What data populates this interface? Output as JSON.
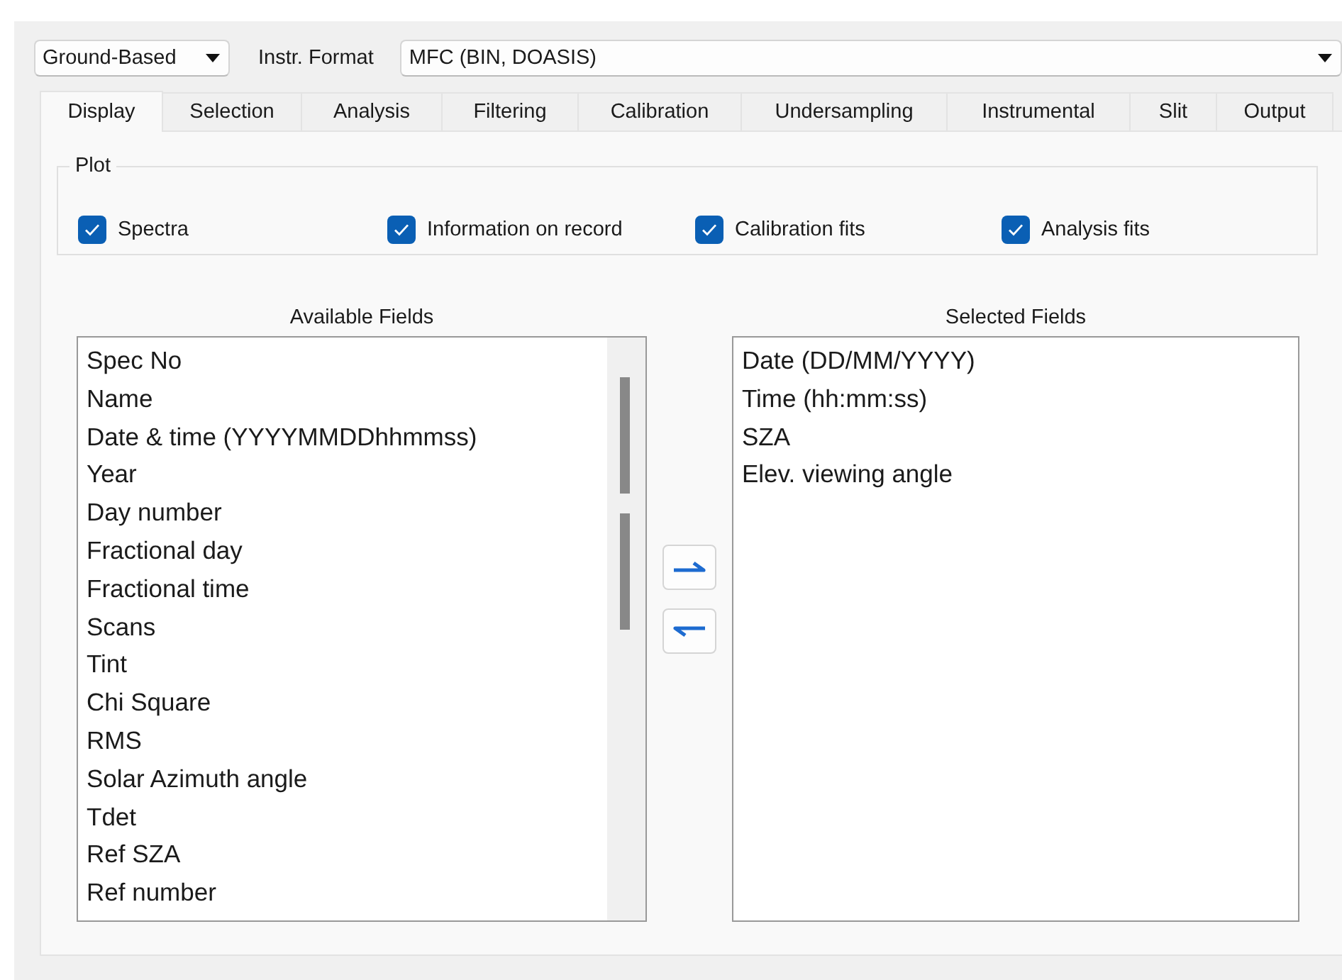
{
  "source_combo": {
    "value": "Ground-Based"
  },
  "format_label": "Instr. Format",
  "format_combo": {
    "value": "MFC (BIN, DOASIS)"
  },
  "tabs": [
    {
      "label": "Display",
      "selected": true
    },
    {
      "label": "Selection",
      "selected": false
    },
    {
      "label": "Analysis",
      "selected": false
    },
    {
      "label": "Filtering",
      "selected": false
    },
    {
      "label": "Calibration",
      "selected": false
    },
    {
      "label": "Undersampling",
      "selected": false
    },
    {
      "label": "Instrumental",
      "selected": false
    },
    {
      "label": "Slit",
      "selected": false
    },
    {
      "label": "Output",
      "selected": false
    }
  ],
  "plot_group": {
    "title": "Plot",
    "checkboxes": [
      {
        "label": "Spectra",
        "checked": true
      },
      {
        "label": "Information on record",
        "checked": true
      },
      {
        "label": "Calibration fits",
        "checked": true
      },
      {
        "label": "Analysis fits",
        "checked": true
      }
    ]
  },
  "available_fields": {
    "title": "Available Fields",
    "items": [
      "Spec No",
      "Name",
      "Date & time (YYYYMMDDhhmmss)",
      "Year",
      "Day number",
      "Fractional day",
      "Fractional time",
      "Scans",
      "Tint",
      "Chi Square",
      "RMS",
      "Solar Azimuth angle",
      "Tdet",
      "Ref SZA",
      "Ref number"
    ]
  },
  "selected_fields": {
    "title": "Selected Fields",
    "items": [
      "Date (DD/MM/YYYY)",
      "Time (hh:mm:ss)",
      "SZA",
      "Elev. viewing angle"
    ]
  }
}
